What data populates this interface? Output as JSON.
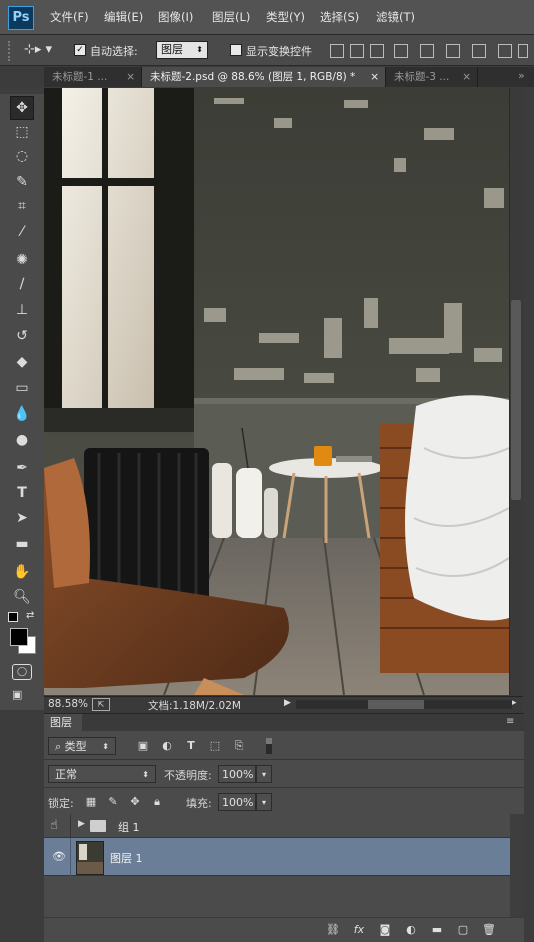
{
  "app": {
    "logo": "Ps"
  },
  "menubar": {
    "items": [
      "文件(F)",
      "编辑(E)",
      "图像(I)",
      "图层(L)",
      "类型(Y)",
      "选择(S)",
      "滤镜(T)"
    ]
  },
  "options": {
    "auto_select_label": "自动选择:",
    "auto_select_checked": true,
    "auto_select_target": "图层",
    "show_transform_label": "显示变换控件",
    "show_transform_checked": false
  },
  "tabs": [
    {
      "label": "未标题-1 ...",
      "active": false
    },
    {
      "label": "未标题-2.psd @ 88.6% (图层 1, RGB/8) *",
      "active": true
    },
    {
      "label": "未标题-3 ...",
      "active": false
    }
  ],
  "tools": [
    "move-icon",
    "marquee-icon",
    "lasso-icon",
    "quick-select-icon",
    "crop-icon",
    "eyedropper-icon",
    "healing-brush-icon",
    "brush-icon",
    "clone-stamp-icon",
    "history-brush-icon",
    "eraser-icon",
    "gradient-icon",
    "blur-icon",
    "dodge-icon",
    "pen-icon",
    "type-icon",
    "path-select-icon",
    "rectangle-icon",
    "hand-icon",
    "zoom-icon"
  ],
  "colors": {
    "foreground": "#000000",
    "background": "#ffffff",
    "layer_selected": "#6b7e98"
  },
  "status": {
    "zoom": "88.58%",
    "doc": "文档:1.18M/2.02M"
  },
  "layers_panel": {
    "title": "图层",
    "filter_label": "类型",
    "blend_mode": "正常",
    "opacity_label": "不透明度:",
    "opacity": "100%",
    "lock_label": "锁定:",
    "fill_label": "填充:",
    "fill": "100%",
    "layers": [
      {
        "name": "组 1",
        "type": "group",
        "selected": false
      },
      {
        "name": "图层 1",
        "type": "pixel",
        "selected": true
      }
    ]
  }
}
